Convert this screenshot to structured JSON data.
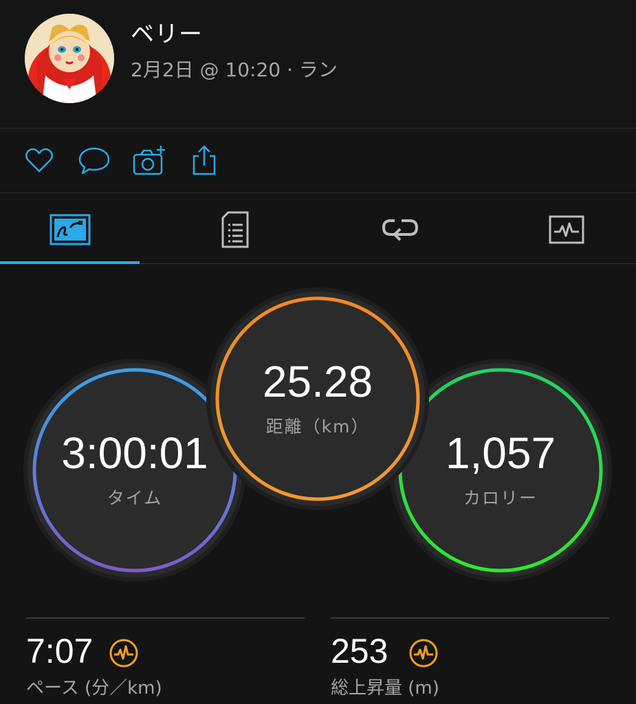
{
  "user": {
    "name": "ベリー",
    "activity_meta": "2月2日 @ 10:20 · ラン"
  },
  "actions": {
    "icons": [
      "heart-icon",
      "comment-icon",
      "camera-add-icon",
      "share-icon"
    ],
    "accent_color": "#2ba8e6"
  },
  "tabs": {
    "icons": [
      "overview-icon",
      "details-icon",
      "laps-icon",
      "charts-icon"
    ],
    "active_index": 0
  },
  "stats": {
    "time": {
      "value": "3:00:01",
      "label": "タイム",
      "ring_colors": [
        "#3aa0e8",
        "#7a5ec8"
      ]
    },
    "distance": {
      "value": "25.28",
      "label": "距離（km）",
      "ring_colors": [
        "#f08a24",
        "#f29a2e"
      ]
    },
    "calories": {
      "value": "1,057",
      "label": "カロリー",
      "ring_colors": [
        "#1fd36a",
        "#2ee82a"
      ]
    }
  },
  "bottom_stats": {
    "pace": {
      "value": "7:07",
      "label": "ペース (分／km)",
      "icon": "performance-icon"
    },
    "ascent": {
      "value": "253",
      "label": "総上昇量 (m)",
      "icon": "performance-icon"
    },
    "icon_color": "#f0a020"
  }
}
